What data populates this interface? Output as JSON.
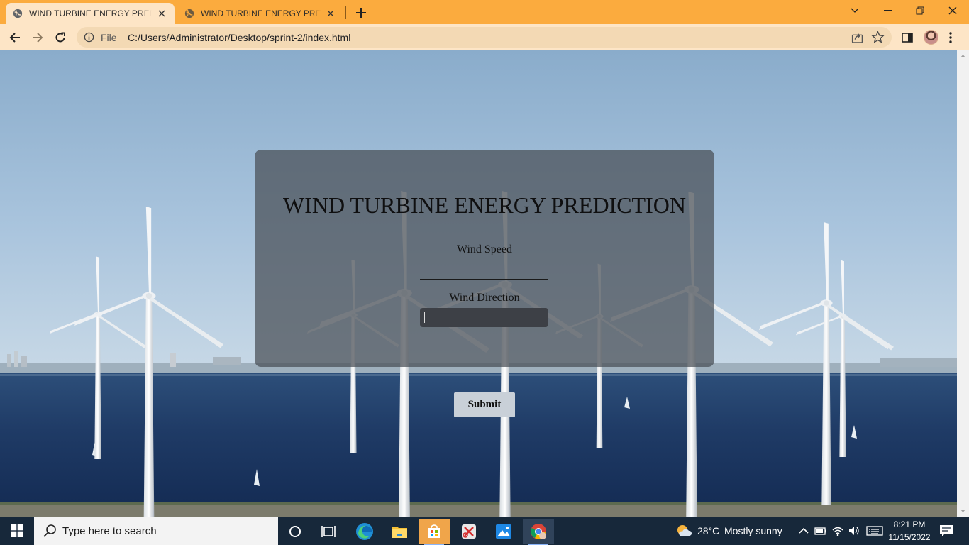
{
  "browser": {
    "tabs": [
      {
        "title": "WIND TURBINE ENERGY PREDICTION",
        "active": true
      },
      {
        "title": "WIND TURBINE ENERGY PREDICTION",
        "active": false
      }
    ],
    "address": {
      "scheme_label": "File",
      "url": "C:/Users/Administrator/Desktop/sprint-2/index.html"
    },
    "colors": {
      "tab_strip": "#fbab3e",
      "toolbar": "#fde5c6"
    }
  },
  "page": {
    "title": "WIND TURBINE ENERGY PREDICTION",
    "fields": [
      {
        "label": "Wind Speed",
        "value": ""
      },
      {
        "label": "Wind Direction",
        "value": ""
      }
    ],
    "submit_label": "Submit",
    "background": "offshore wind turbines over sea under blue sky"
  },
  "taskbar": {
    "search_placeholder": "Type here to search",
    "weather": {
      "temp": "28°C",
      "condition": "Mostly sunny"
    },
    "clock": {
      "time": "8:21 PM",
      "date": "11/15/2022"
    },
    "pinned": [
      "task-view-icon",
      "widgets-icon",
      "edge-icon",
      "file-explorer-icon",
      "store-icon",
      "app-icon",
      "photos-icon",
      "chrome-icon"
    ]
  }
}
